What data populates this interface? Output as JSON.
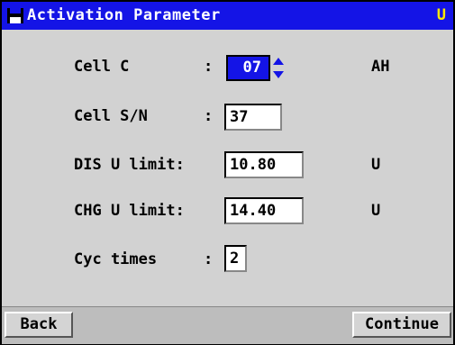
{
  "window": {
    "title": "Activation Parameter",
    "title_right_indicator": "U",
    "colors": {
      "titlebar": "#1414e6",
      "title_text": "#ffffff",
      "indicator": "#ffe800",
      "background": "#d2d2d2"
    }
  },
  "form": {
    "cell_c": {
      "label": "Cell C",
      "colon": ":",
      "value": "07",
      "unit": "AH"
    },
    "cell_sn": {
      "label": "Cell S/N",
      "colon": ":",
      "value": "37"
    },
    "dis_u_limit": {
      "label": "DIS U limit:",
      "value": "10.80",
      "unit": "U"
    },
    "chg_u_limit": {
      "label": "CHG U limit:",
      "value": "14.40",
      "unit": "U"
    },
    "cyc_times": {
      "label": "Cyc times",
      "colon": ":",
      "value": "2"
    }
  },
  "buttons": {
    "back": "Back",
    "continue": "Continue"
  }
}
